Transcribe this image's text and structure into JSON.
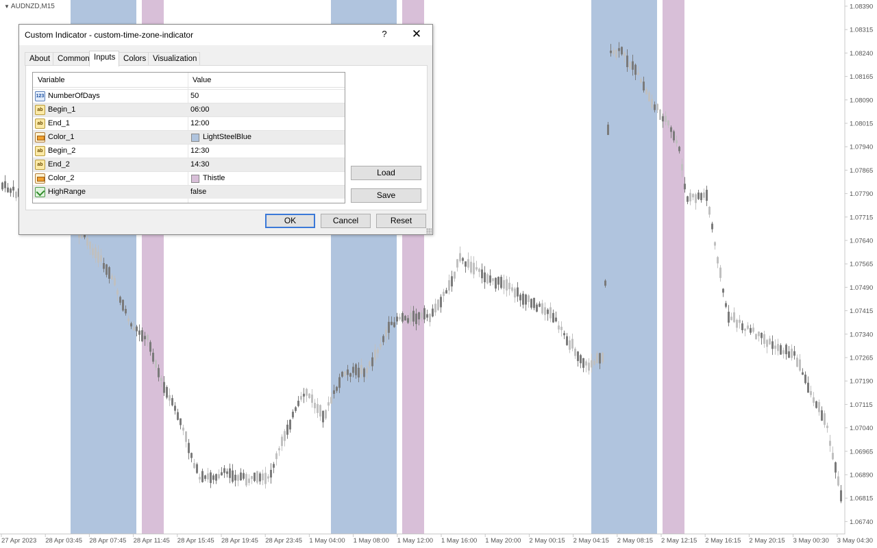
{
  "chart": {
    "symbol_label": "AUDNZD,M15",
    "price_labels": [
      "1.08390",
      "1.08315",
      "1.08240",
      "1.08165",
      "1.08090",
      "1.08015",
      "1.07940",
      "1.07865",
      "1.07790",
      "1.07715",
      "1.07640",
      "1.07565",
      "1.07490",
      "1.07415",
      "1.07340",
      "1.07265",
      "1.07190",
      "1.07115",
      "1.07040",
      "1.06965",
      "1.06890",
      "1.06815",
      "1.06740"
    ],
    "time_labels": [
      "27 Apr 2023",
      "28 Apr 03:45",
      "28 Apr 07:45",
      "28 Apr 11:45",
      "28 Apr 15:45",
      "28 Apr 19:45",
      "28 Apr 23:45",
      "1 May 04:00",
      "1 May 08:00",
      "1 May 12:00",
      "1 May 16:00",
      "1 May 20:00",
      "2 May 00:15",
      "2 May 04:15",
      "2 May 08:15",
      "2 May 12:15",
      "2 May 16:15",
      "2 May 20:15",
      "3 May 00:30",
      "3 May 04:30"
    ],
    "colors": {
      "zone1": "#B0C4DE",
      "zone2": "#D8BFD8",
      "bull_candle": "#c0c0c0",
      "bear_candle": "#7a7a7a",
      "axis": "#c8c8c8",
      "label": "#555555"
    }
  },
  "dialog": {
    "title": "Custom Indicator - custom-time-zone-indicator",
    "help_glyph": "?",
    "close_glyph": "✕",
    "tabs": [
      {
        "label": "About",
        "active": false
      },
      {
        "label": "Common",
        "active": false
      },
      {
        "label": "Inputs",
        "active": true
      },
      {
        "label": "Colors",
        "active": false
      },
      {
        "label": "Visualization",
        "active": false
      }
    ],
    "table": {
      "headers": {
        "variable": "Variable",
        "value": "Value"
      },
      "rows": [
        {
          "icon": "int",
          "icon_text": "123",
          "variable": "NumberOfDays",
          "value": "50"
        },
        {
          "icon": "str",
          "icon_text": "ab",
          "variable": "Begin_1",
          "value": "06:00"
        },
        {
          "icon": "str",
          "icon_text": "ab",
          "variable": "End_1",
          "value": "12:00"
        },
        {
          "icon": "col",
          "icon_text": "",
          "variable": "Color_1",
          "value": "LightSteelBlue",
          "swatch": "#B0C4DE"
        },
        {
          "icon": "str",
          "icon_text": "ab",
          "variable": "Begin_2",
          "value": "12:30"
        },
        {
          "icon": "str",
          "icon_text": "ab",
          "variable": "End_2",
          "value": "14:30"
        },
        {
          "icon": "col",
          "icon_text": "",
          "variable": "Color_2",
          "value": "Thistle",
          "swatch": "#D8BFD8"
        },
        {
          "icon": "bool",
          "icon_text": "",
          "variable": "HighRange",
          "value": "false"
        }
      ]
    },
    "buttons": {
      "load": "Load",
      "save": "Save",
      "ok": "OK",
      "cancel": "Cancel",
      "reset": "Reset"
    }
  }
}
